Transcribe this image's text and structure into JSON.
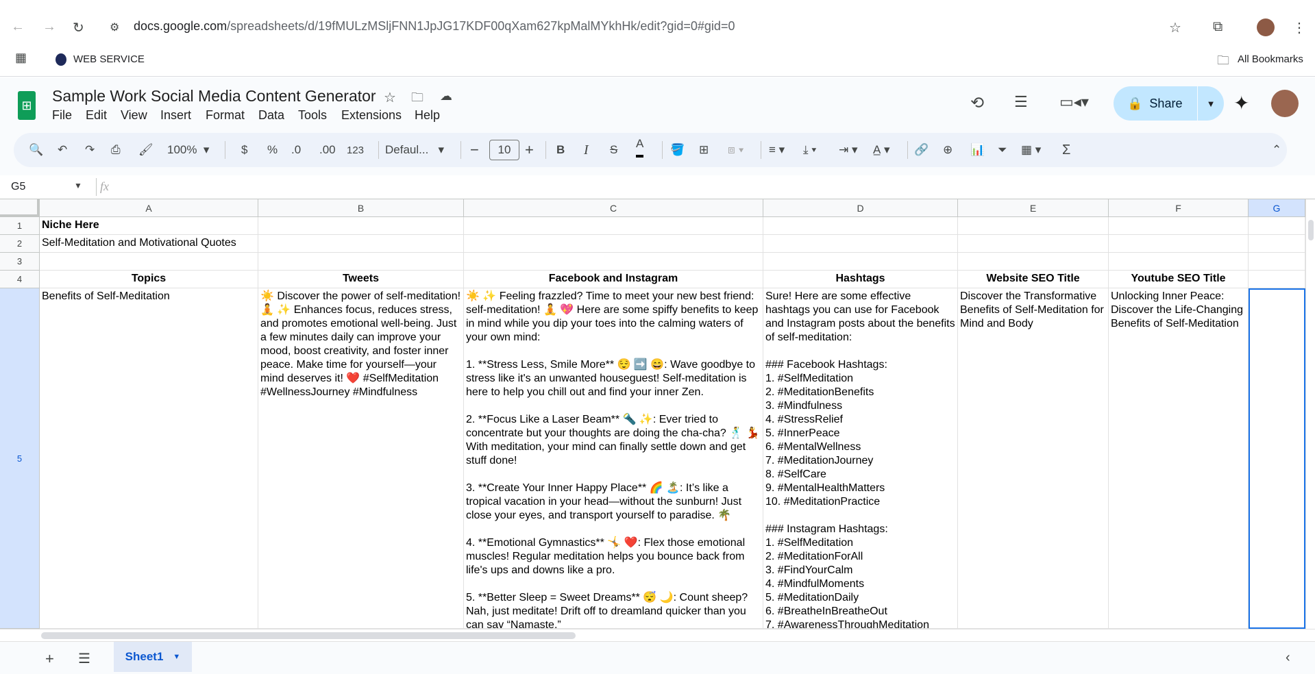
{
  "browser": {
    "url_host": "docs.google.com",
    "url_path": "/spreadsheets/d/19fMULzMSljFNN1JpJG17KDF00qXam627kpMalMYkhHk/edit?gid=0#gid=0",
    "bookmark": "WEB SERVICE",
    "all_bookmarks": "All Bookmarks"
  },
  "doc": {
    "title": "Sample Work Social Media Content Generator",
    "menus": [
      "File",
      "Edit",
      "View",
      "Insert",
      "Format",
      "Data",
      "Tools",
      "Extensions",
      "Help"
    ],
    "share": "Share"
  },
  "toolbar": {
    "zoom": "100%",
    "currency": "$",
    "percent": "%",
    "dec_decrease": ".0",
    "dec_increase": ".00",
    "number_format": "123",
    "font": "Defaul...",
    "font_size": "10",
    "bold": "B",
    "italic": "I",
    "text_color": "A",
    "sum": "Σ"
  },
  "formula": {
    "cell_ref": "G5",
    "fx": "fx"
  },
  "columns": [
    "A",
    "B",
    "C",
    "D",
    "E",
    "F",
    "G"
  ],
  "rows": [
    "1",
    "2",
    "3",
    "4",
    "5"
  ],
  "cells": {
    "A1": "Niche Here",
    "A2": "Self-Meditation and Motivational Quotes",
    "A4": "Topics",
    "B4": "Tweets",
    "C4": "Facebook and Instagram",
    "D4": "Hashtags",
    "E4": "Website SEO Title",
    "F4": "Youtube SEO Title",
    "A5": "Benefits of Self-Meditation",
    "B5": "☀️ Discover the power of self-meditation! 🧘 ✨ Enhances focus, reduces stress, and promotes emotional well-being. Just a few minutes daily can improve your mood, boost creativity, and foster inner peace. Make time for yourself—your mind deserves it! ❤️ #SelfMeditation #WellnessJourney #Mindfulness",
    "C5": "☀️ ✨ Feeling frazzled? Time to meet your new best friend: self-meditation! 🧘 💖 Here are some spiffy benefits to keep in mind while you dip your toes into the calming waters of your own mind:\n\n1. **Stress Less, Smile More** 😌 ➡️ 😄: Wave goodbye to stress like it's an unwanted houseguest! Self-meditation is here to help you chill out and find your inner Zen.\n\n2. **Focus Like a Laser Beam** 🔦 ✨: Ever tried to concentrate but your thoughts are doing the cha-cha? 🕺 💃 With meditation, your mind can finally settle down and get stuff done!\n\n3. **Create Your Inner Happy Place** 🌈 🏝️: It’s like a tropical vacation in your head—without the sunburn! Just close your eyes, and transport yourself to paradise. 🌴\n\n4. **Emotional Gymnastics** 🤸 ❤️: Flex those emotional muscles! Regular meditation helps you bounce back from life's ups and downs like a pro.\n\n5. **Better Sleep = Sweet Dreams** 😴 🌙: Count sheep? Nah, just meditate! Drift off to dreamland quicker than you can say “Namaste.”",
    "D5": "Sure! Here are some effective hashtags you can use for Facebook and Instagram posts about the benefits of self-meditation:\n\n### Facebook Hashtags:\n1. #SelfMeditation\n2. #MeditationBenefits\n3. #Mindfulness\n4. #StressRelief\n5. #InnerPeace\n6. #MentalWellness\n7. #MeditationJourney\n8. #SelfCare\n9. #MentalHealthMatters\n10. #MeditationPractice\n\n### Instagram Hashtags:\n1. #SelfMeditation\n2. #MeditationForAll\n3. #FindYourCalm\n4. #MindfulMoments\n5. #MeditationDaily\n6. #BreatheInBreatheOut\n7. #AwarenessThroughMeditation",
    "E5": "Discover the Transformative Benefits of Self-Meditation for Mind and Body",
    "F5": "Unlocking Inner Peace: Discover the Life-Changing Benefits of Self-Meditation"
  },
  "sheets": [
    {
      "name": "Sheet1"
    }
  ],
  "colors": {
    "share_bg": "#c2e7ff",
    "selection": "#1a73e8",
    "sheets_green": "#0f9d58"
  }
}
